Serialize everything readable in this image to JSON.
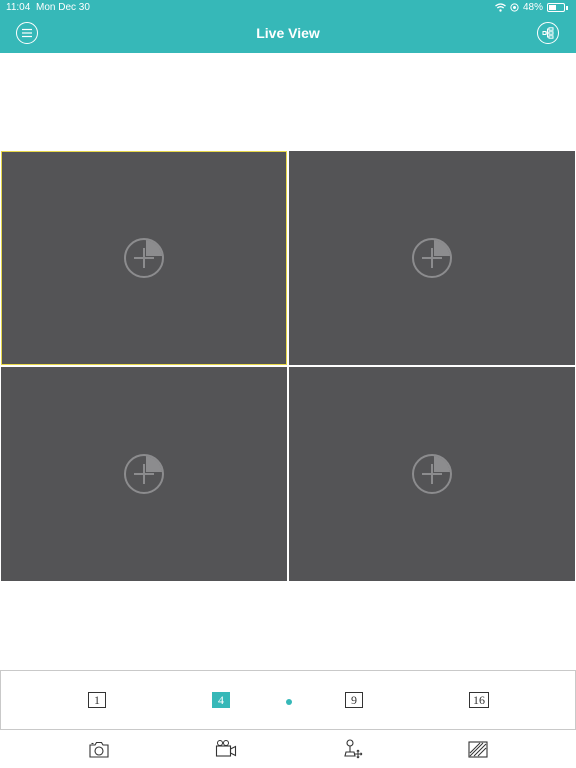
{
  "status": {
    "time": "11:04",
    "date": "Mon Dec 30",
    "battery_percent": "48%",
    "battery_level": 0.48
  },
  "header": {
    "title": "Live View",
    "left_icon": "menu-icon",
    "right_icon": "device-tree-icon"
  },
  "colors": {
    "accent": "#36b8b8",
    "cell_bg": "#545456",
    "selected_border": "#e8d84a"
  },
  "cells": [
    {
      "icon": "add-camera-icon",
      "selected": true
    },
    {
      "icon": "add-camera-icon",
      "selected": false
    },
    {
      "icon": "add-camera-icon",
      "selected": false
    },
    {
      "icon": "add-camera-icon",
      "selected": false
    }
  ],
  "layouts": [
    {
      "label": "1",
      "active": false
    },
    {
      "label": "4",
      "active": true
    },
    {
      "label": "9",
      "active": false
    },
    {
      "label": "16",
      "active": false
    }
  ],
  "toolbar": [
    {
      "icon": "snapshot-camera-icon"
    },
    {
      "icon": "record-video-icon"
    },
    {
      "icon": "ptz-control-icon"
    },
    {
      "icon": "image-quality-icon"
    }
  ]
}
